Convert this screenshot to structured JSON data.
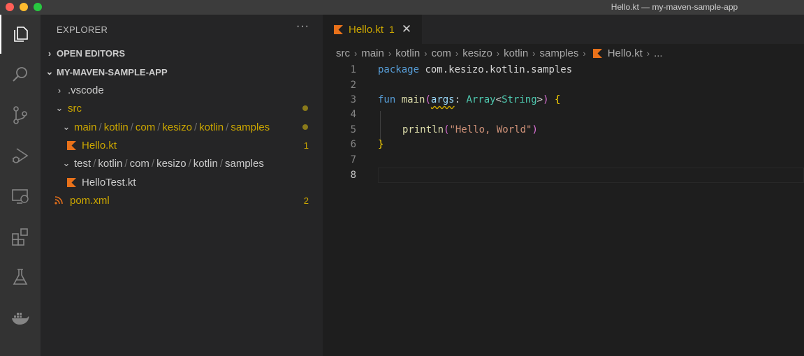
{
  "window": {
    "title": "Hello.kt — my-maven-sample-app"
  },
  "activity_bar": [
    "files-icon",
    "search-icon",
    "source-control-icon",
    "run-debug-icon",
    "remote-explorer-icon",
    "extensions-icon",
    "testing-icon",
    "docker-icon"
  ],
  "sidebar": {
    "title": "EXPLORER",
    "more": "···",
    "open_editors": "OPEN EDITORS",
    "project": "MY-MAVEN-SAMPLE-APP",
    "tree": {
      "vscode": ".vscode",
      "src": "src",
      "main_path": [
        "main",
        "kotlin",
        "com",
        "kesizo",
        "kotlin",
        "samples"
      ],
      "hello": "Hello.kt",
      "hello_badge": "1",
      "test_path": [
        "test",
        "kotlin",
        "com",
        "kesizo",
        "kotlin",
        "samples"
      ],
      "hellotest": "HelloTest.kt",
      "pom": "pom.xml",
      "pom_badge": "2"
    }
  },
  "editor": {
    "tab": {
      "name": "Hello.kt",
      "problems": "1",
      "close": "✕"
    },
    "breadcrumbs": [
      "src",
      "main",
      "kotlin",
      "com",
      "kesizo",
      "kotlin",
      "samples",
      "Hello.kt",
      "..."
    ],
    "current_line": 8,
    "lines": {
      "n": [
        "1",
        "2",
        "3",
        "4",
        "5",
        "6",
        "7",
        "8"
      ],
      "l1_kw": "package",
      "l1_rest": " com.kesizo.kotlin.samples",
      "l3_kw": "fun",
      "l3_fn": " main",
      "l3_paren": "(",
      "l3_param": "args",
      "l3_colon": ": ",
      "l3_type": "Array",
      "l3_lt": "<",
      "l3_type2": "String",
      "l3_gt": ">",
      "l3_close": ")",
      "l3_brace": " {",
      "l5_fn": "println",
      "l5_open": "(",
      "l5_str": "\"Hello, World\"",
      "l5_close": ")",
      "l6_brace": "}"
    }
  },
  "colors": {
    "modified": "#cca700",
    "kotlin_icon": "#e8711a",
    "rss_icon": "#e8711a"
  }
}
